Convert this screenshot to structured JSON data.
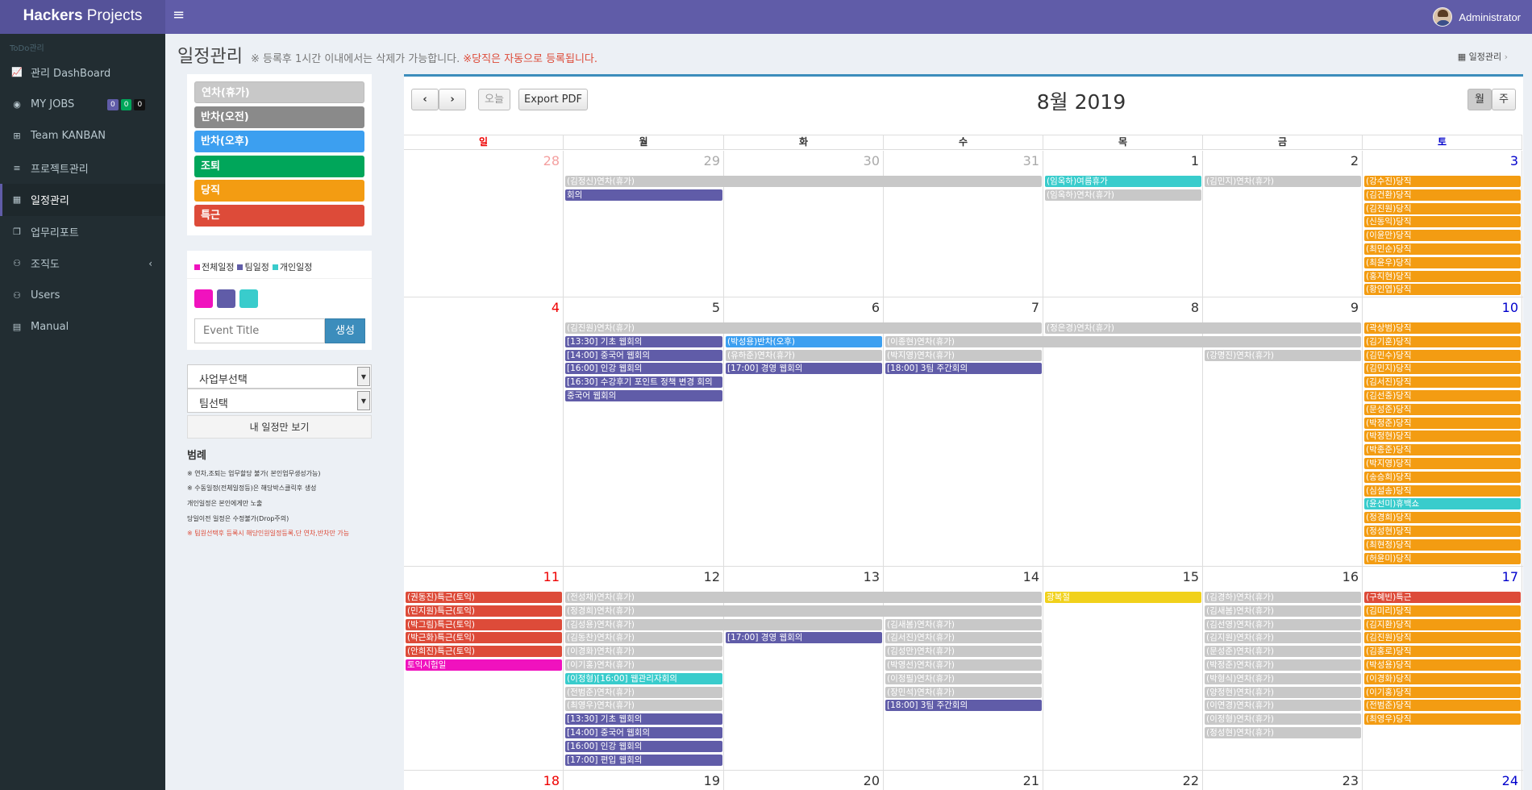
{
  "app": {
    "brand_bold": "Hackers",
    "brand_rest": " Projects",
    "user": "Administrator"
  },
  "colors": {
    "topbar": "#605ca8",
    "sidebar": "#222d32",
    "leave": "#c8c8c8",
    "half_am": "#8a8a8a",
    "half_pm": "#3c9ff0",
    "early": "#00a65a",
    "duty": "#f39c12",
    "special": "#dd4b39",
    "team": "#605ca8",
    "all": "#f012be",
    "personal": "#39cccc",
    "yellow": "#f1d11b"
  },
  "sidebar": {
    "header": "ToDo관리",
    "items": [
      {
        "name": "sidebar-item-dashboard",
        "icon": "area-chart-icon",
        "glyph": "📈",
        "label": "관리 DashBoard"
      },
      {
        "name": "sidebar-item-myjobs",
        "icon": "dashboard-icon",
        "glyph": "◉",
        "label": "MY JOBS",
        "badges": [
          {
            "t": "0",
            "c": "#605ca8"
          },
          {
            "t": "0",
            "c": "#00a65a"
          },
          {
            "t": "0",
            "c": "#111"
          }
        ]
      },
      {
        "name": "sidebar-item-kanban",
        "icon": "sitemap-icon",
        "glyph": "⊞",
        "label": "Team KANBAN"
      },
      {
        "name": "sidebar-item-projects",
        "icon": "list-icon",
        "glyph": "≡",
        "label": "프로젝트관리"
      },
      {
        "name": "sidebar-item-schedule",
        "icon": "calendar-icon",
        "glyph": "▦",
        "label": "일정관리",
        "active": true
      },
      {
        "name": "sidebar-item-report",
        "icon": "copy-icon",
        "glyph": "❐",
        "label": "업무리포트"
      },
      {
        "name": "sidebar-item-org",
        "icon": "users-icon",
        "glyph": "⚇",
        "label": "조직도",
        "chevron": "‹"
      },
      {
        "name": "sidebar-item-users",
        "icon": "users-icon",
        "glyph": "⚇",
        "label": "Users"
      },
      {
        "name": "sidebar-item-manual",
        "icon": "file-icon",
        "glyph": "▤",
        "label": "Manual"
      }
    ]
  },
  "header": {
    "title": "일정관리",
    "note": "※ 등록후 1시간 이내에서는 삭제가 가능합니다.",
    "note_red": "※당직은 자동으로 등록됩니다.",
    "breadcrumb": "일정관리"
  },
  "types": [
    {
      "label": "연차(휴가)",
      "c": "#c8c8c8"
    },
    {
      "label": "반차(오전)",
      "c": "#8a8a8a"
    },
    {
      "label": "반차(오후)",
      "c": "#3c9ff0"
    },
    {
      "label": "조퇴",
      "c": "#00a65a"
    },
    {
      "label": "당직",
      "c": "#f39c12"
    },
    {
      "label": "특근",
      "c": "#dd4b39"
    }
  ],
  "create": {
    "legend": [
      {
        "label": "전체일정",
        "c": "#f012be"
      },
      {
        "label": "팀일정",
        "c": "#605ca8"
      },
      {
        "label": "개인일정",
        "c": "#39cccc"
      }
    ],
    "placeholder": "Event Title",
    "button": "생성"
  },
  "filters": {
    "business": "사업부선택",
    "team": "팀선택",
    "my_only": "내 일정만 보기"
  },
  "legend": {
    "title": "범례",
    "lines": [
      "※ 연차,조퇴는 업무할당 불가( 본인업무생성가능)",
      "※ 수동일정(전체일정등)은 해당박스클릭후 생성",
      "개인일정은 본인에게만 노출",
      "당일이전 일정은 수정불가(Drop주의)"
    ],
    "red": "※ 팀원선택후 등록시 해당인원일정등록,단 연차,반차만 가능"
  },
  "calendar": {
    "title": "8월 2019",
    "today": "오늘",
    "export": "Export PDF",
    "view_month": "월",
    "view_week": "주",
    "weekdays": [
      "일",
      "월",
      "화",
      "수",
      "목",
      "금",
      "토"
    ],
    "weeks": [
      {
        "days": [
          "28",
          "29",
          "30",
          "31",
          "1",
          "2",
          "3"
        ],
        "other": [
          0,
          1,
          2,
          3
        ],
        "events": [
          {
            "t": "(김정신)연차(휴가)",
            "s": 1,
            "e": 3,
            "r": 0,
            "k": "leave"
          },
          {
            "t": "회의",
            "s": 1,
            "e": 1,
            "r": 1,
            "k": "team"
          },
          {
            "t": "(임옥하)여름휴가",
            "s": 4,
            "e": 4,
            "r": 0,
            "k": "personal"
          },
          {
            "t": "(임옥하)연차(휴가)",
            "s": 4,
            "e": 4,
            "r": 1,
            "k": "leave"
          },
          {
            "t": "(김민지)연차(휴가)",
            "s": 5,
            "e": 5,
            "r": 0,
            "k": "leave"
          },
          {
            "t": "(강수진)당직",
            "s": 6,
            "e": 6,
            "r": 0,
            "k": "duty"
          },
          {
            "t": "(김건환)당직",
            "s": 6,
            "e": 6,
            "r": 1,
            "k": "duty"
          },
          {
            "t": "(김진원)당직",
            "s": 6,
            "e": 6,
            "r": 2,
            "k": "duty"
          },
          {
            "t": "(신동익)당직",
            "s": 6,
            "e": 6,
            "r": 3,
            "k": "duty"
          },
          {
            "t": "(이윤만)당직",
            "s": 6,
            "e": 6,
            "r": 4,
            "k": "duty"
          },
          {
            "t": "(최민순)당직",
            "s": 6,
            "e": 6,
            "r": 5,
            "k": "duty"
          },
          {
            "t": "(최윤우)당직",
            "s": 6,
            "e": 6,
            "r": 6,
            "k": "duty"
          },
          {
            "t": "(홍지현)당직",
            "s": 6,
            "e": 6,
            "r": 7,
            "k": "duty"
          },
          {
            "t": "(황인엽)당직",
            "s": 6,
            "e": 6,
            "r": 8,
            "k": "duty"
          }
        ]
      },
      {
        "days": [
          "4",
          "5",
          "6",
          "7",
          "8",
          "9",
          "10"
        ],
        "other": [],
        "events": [
          {
            "t": "(김진원)연차(휴가)",
            "s": 1,
            "e": 3,
            "r": 0,
            "k": "leave"
          },
          {
            "t": "(정은경)연차(휴가)",
            "s": 4,
            "e": 5,
            "r": 0,
            "k": "leave"
          },
          {
            "t": "[13:30] 기초 웹회의",
            "s": 1,
            "e": 1,
            "r": 1,
            "k": "team"
          },
          {
            "t": "(박성용)반차(오후)",
            "s": 2,
            "e": 2,
            "r": 1,
            "k": "half_pm"
          },
          {
            "t": "(이종현)연차(휴가)",
            "s": 3,
            "e": 5,
            "r": 1,
            "k": "leave"
          },
          {
            "t": "[14:00] 중국어 웹회의",
            "s": 1,
            "e": 1,
            "r": 2,
            "k": "team"
          },
          {
            "t": "(유하준)연차(휴가)",
            "s": 2,
            "e": 2,
            "r": 2,
            "k": "leave"
          },
          {
            "t": "(박지영)연차(휴가)",
            "s": 3,
            "e": 3,
            "r": 2,
            "k": "leave"
          },
          {
            "t": "(강명진)연차(휴가)",
            "s": 5,
            "e": 5,
            "r": 2,
            "k": "leave"
          },
          {
            "t": "[16:00] 인강 웹회의",
            "s": 1,
            "e": 1,
            "r": 3,
            "k": "team"
          },
          {
            "t": "[17:00] 경영 웹회의",
            "s": 2,
            "e": 2,
            "r": 3,
            "k": "team"
          },
          {
            "t": "[18:00] 3팀 주간회의",
            "s": 3,
            "e": 3,
            "r": 3,
            "k": "team"
          },
          {
            "t": "[16:30] 수강후기 포인트 정책 변경 회의",
            "s": 1,
            "e": 1,
            "r": 4,
            "k": "team"
          },
          {
            "t": "중국어 웹회의",
            "s": 1,
            "e": 1,
            "r": 5,
            "k": "team"
          },
          {
            "t": "(곽상범)당직",
            "s": 6,
            "e": 6,
            "r": 0,
            "k": "duty"
          },
          {
            "t": "(김기훈)당직",
            "s": 6,
            "e": 6,
            "r": 1,
            "k": "duty"
          },
          {
            "t": "(김민수)당직",
            "s": 6,
            "e": 6,
            "r": 2,
            "k": "duty"
          },
          {
            "t": "(김민지)당직",
            "s": 6,
            "e": 6,
            "r": 3,
            "k": "duty"
          },
          {
            "t": "(김서진)당직",
            "s": 6,
            "e": 6,
            "r": 4,
            "k": "duty"
          },
          {
            "t": "(김선중)당직",
            "s": 6,
            "e": 6,
            "r": 5,
            "k": "duty"
          },
          {
            "t": "(문성준)당직",
            "s": 6,
            "e": 6,
            "r": 6,
            "k": "duty"
          },
          {
            "t": "(박정준)당직",
            "s": 6,
            "e": 6,
            "r": 7,
            "k": "duty"
          },
          {
            "t": "(박정현)당직",
            "s": 6,
            "e": 6,
            "r": 8,
            "k": "duty"
          },
          {
            "t": "(박종준)당직",
            "s": 6,
            "e": 6,
            "r": 9,
            "k": "duty"
          },
          {
            "t": "(박지영)당직",
            "s": 6,
            "e": 6,
            "r": 10,
            "k": "duty"
          },
          {
            "t": "(송승희)당직",
            "s": 6,
            "e": 6,
            "r": 11,
            "k": "duty"
          },
          {
            "t": "(심설송)당직",
            "s": 6,
            "e": 6,
            "r": 12,
            "k": "duty"
          },
          {
            "t": "(윤선미)휴백쇼",
            "s": 6,
            "e": 6,
            "r": 13,
            "k": "personal"
          },
          {
            "t": "(정경희)당직",
            "s": 6,
            "e": 6,
            "r": 14,
            "k": "duty"
          },
          {
            "t": "(정성현)당직",
            "s": 6,
            "e": 6,
            "r": 15,
            "k": "duty"
          },
          {
            "t": "(최현정)당직",
            "s": 6,
            "e": 6,
            "r": 16,
            "k": "duty"
          },
          {
            "t": "(허윤미)당직",
            "s": 6,
            "e": 6,
            "r": 17,
            "k": "duty"
          }
        ]
      },
      {
        "days": [
          "11",
          "12",
          "13",
          "14",
          "15",
          "16",
          "17"
        ],
        "other": [],
        "events": [
          {
            "t": "(권동진)특근(토익)",
            "s": 0,
            "e": 0,
            "r": 0,
            "k": "special"
          },
          {
            "t": "(민지원)특근(토익)",
            "s": 0,
            "e": 0,
            "r": 1,
            "k": "special"
          },
          {
            "t": "(박그림)특근(토익)",
            "s": 0,
            "e": 0,
            "r": 2,
            "k": "special"
          },
          {
            "t": "(박근화)특근(토익)",
            "s": 0,
            "e": 0,
            "r": 3,
            "k": "special"
          },
          {
            "t": "(안희진)특근(토익)",
            "s": 0,
            "e": 0,
            "r": 4,
            "k": "special"
          },
          {
            "t": "토익시험일",
            "s": 0,
            "e": 0,
            "r": 5,
            "k": "all"
          },
          {
            "t": "(전성채)연차(휴가)",
            "s": 1,
            "e": 3,
            "r": 0,
            "k": "leave"
          },
          {
            "t": "광복절",
            "s": 4,
            "e": 4,
            "r": 0,
            "k": "yellow"
          },
          {
            "t": "(김경하)연차(휴가)",
            "s": 5,
            "e": 5,
            "r": 0,
            "k": "leave"
          },
          {
            "t": "(구혜빈)특근",
            "s": 6,
            "e": 6,
            "r": 0,
            "k": "special"
          },
          {
            "t": "(정경희)연차(휴가)",
            "s": 1,
            "e": 3,
            "r": 1,
            "k": "leave"
          },
          {
            "t": "(김새봄)연차(휴가)",
            "s": 5,
            "e": 5,
            "r": 1,
            "k": "leave"
          },
          {
            "t": "(김미리)당직",
            "s": 6,
            "e": 6,
            "r": 1,
            "k": "duty"
          },
          {
            "t": "(김성용)연차(휴가)",
            "s": 1,
            "e": 2,
            "r": 2,
            "k": "leave"
          },
          {
            "t": "(김새봄)연차(휴가)",
            "s": 3,
            "e": 3,
            "r": 2,
            "k": "leave"
          },
          {
            "t": "(김선영)연차(휴가)",
            "s": 5,
            "e": 5,
            "r": 2,
            "k": "leave"
          },
          {
            "t": "(김지환)당직",
            "s": 6,
            "e": 6,
            "r": 2,
            "k": "duty"
          },
          {
            "t": "(김동찬)연차(휴가)",
            "s": 1,
            "e": 1,
            "r": 3,
            "k": "leave"
          },
          {
            "t": "[17:00] 경영 웹회의",
            "s": 2,
            "e": 2,
            "r": 3,
            "k": "team"
          },
          {
            "t": "(김서진)연차(휴가)",
            "s": 3,
            "e": 3,
            "r": 3,
            "k": "leave"
          },
          {
            "t": "(김지원)연차(휴가)",
            "s": 5,
            "e": 5,
            "r": 3,
            "k": "leave"
          },
          {
            "t": "(김진원)당직",
            "s": 6,
            "e": 6,
            "r": 3,
            "k": "duty"
          },
          {
            "t": "(이경화)연차(휴가)",
            "s": 1,
            "e": 1,
            "r": 4,
            "k": "leave"
          },
          {
            "t": "(김성만)연차(휴가)",
            "s": 3,
            "e": 3,
            "r": 4,
            "k": "leave"
          },
          {
            "t": "(문성준)연차(휴가)",
            "s": 5,
            "e": 5,
            "r": 4,
            "k": "leave"
          },
          {
            "t": "(김홍로)당직",
            "s": 6,
            "e": 6,
            "r": 4,
            "k": "duty"
          },
          {
            "t": "(이기홍)연차(휴가)",
            "s": 1,
            "e": 1,
            "r": 5,
            "k": "leave"
          },
          {
            "t": "(박영선)연차(휴가)",
            "s": 3,
            "e": 3,
            "r": 5,
            "k": "leave"
          },
          {
            "t": "(박정준)연차(휴가)",
            "s": 5,
            "e": 5,
            "r": 5,
            "k": "leave"
          },
          {
            "t": "(박성용)당직",
            "s": 6,
            "e": 6,
            "r": 5,
            "k": "duty"
          },
          {
            "t": "(이정형)[16:00] 웹관리자회의",
            "s": 1,
            "e": 1,
            "r": 6,
            "k": "personal"
          },
          {
            "t": "(이정필)연차(휴가)",
            "s": 3,
            "e": 3,
            "r": 6,
            "k": "leave"
          },
          {
            "t": "(박형식)연차(휴가)",
            "s": 5,
            "e": 5,
            "r": 6,
            "k": "leave"
          },
          {
            "t": "(이경화)당직",
            "s": 6,
            "e": 6,
            "r": 6,
            "k": "duty"
          },
          {
            "t": "(전범준)연차(휴가)",
            "s": 1,
            "e": 1,
            "r": 7,
            "k": "leave"
          },
          {
            "t": "(장민석)연차(휴가)",
            "s": 3,
            "e": 3,
            "r": 7,
            "k": "leave"
          },
          {
            "t": "(양정현)연차(휴가)",
            "s": 5,
            "e": 5,
            "r": 7,
            "k": "leave"
          },
          {
            "t": "(이기홍)당직",
            "s": 6,
            "e": 6,
            "r": 7,
            "k": "duty"
          },
          {
            "t": "(최영우)연차(휴가)",
            "s": 1,
            "e": 1,
            "r": 8,
            "k": "leave"
          },
          {
            "t": "[18:00] 3팀 주간회의",
            "s": 3,
            "e": 3,
            "r": 8,
            "k": "team"
          },
          {
            "t": "(이연경)연차(휴가)",
            "s": 5,
            "e": 5,
            "r": 8,
            "k": "leave"
          },
          {
            "t": "(전범준)당직",
            "s": 6,
            "e": 6,
            "r": 8,
            "k": "duty"
          },
          {
            "t": "[13:30] 기초 웹회의",
            "s": 1,
            "e": 1,
            "r": 9,
            "k": "team"
          },
          {
            "t": "(이정형)연차(휴가)",
            "s": 5,
            "e": 5,
            "r": 9,
            "k": "leave"
          },
          {
            "t": "(최영우)당직",
            "s": 6,
            "e": 6,
            "r": 9,
            "k": "duty"
          },
          {
            "t": "[14:00] 중국어 웹회의",
            "s": 1,
            "e": 1,
            "r": 10,
            "k": "team"
          },
          {
            "t": "(정성현)연차(휴가)",
            "s": 5,
            "e": 5,
            "r": 10,
            "k": "leave"
          },
          {
            "t": "[16:00] 인강 웹회의",
            "s": 1,
            "e": 1,
            "r": 11,
            "k": "team"
          },
          {
            "t": "[17:00] 편입 웹회의",
            "s": 1,
            "e": 1,
            "r": 12,
            "k": "team"
          }
        ]
      },
      {
        "days": [
          "18",
          "19",
          "20",
          "21",
          "22",
          "23",
          "24"
        ],
        "other": [],
        "events": []
      }
    ]
  }
}
